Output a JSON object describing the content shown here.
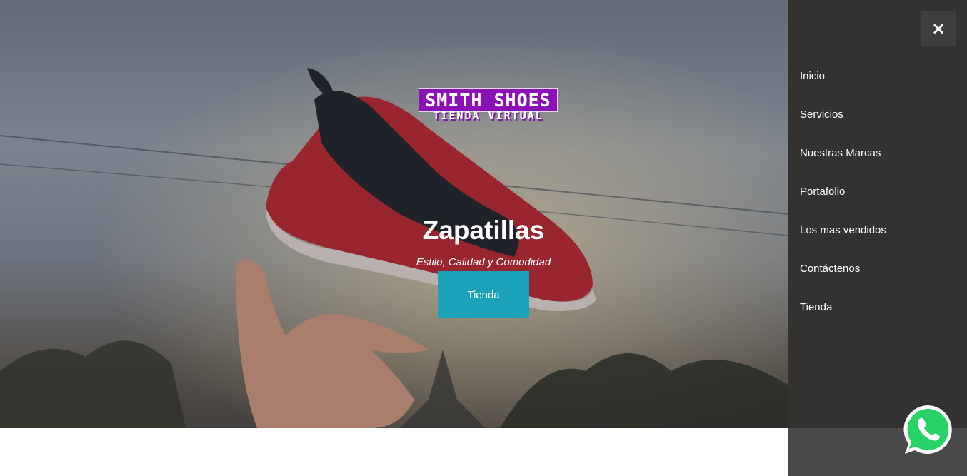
{
  "hero": {
    "logo_title": "SMITH SHOES",
    "logo_subtitle": "TIENDA VIRTUAL",
    "title": "Zapatillas",
    "subtitle": "Estilo, Calidad y Comodidad",
    "button_label": "Tienda"
  },
  "sidebar": {
    "close_label": "×",
    "items": [
      {
        "label": "Inicio"
      },
      {
        "label": "Servicios"
      },
      {
        "label": "Nuestras Marcas"
      },
      {
        "label": "Portafolio"
      },
      {
        "label": "Los mas vendidos"
      },
      {
        "label": "Contáctenos"
      },
      {
        "label": "Tienda"
      }
    ]
  },
  "icons": {
    "whatsapp": "whatsapp-icon",
    "close": "close-icon"
  },
  "colors": {
    "accent_button": "#1ba2b8",
    "logo_purple": "#8a12b5",
    "whatsapp_green": "#25d366"
  }
}
